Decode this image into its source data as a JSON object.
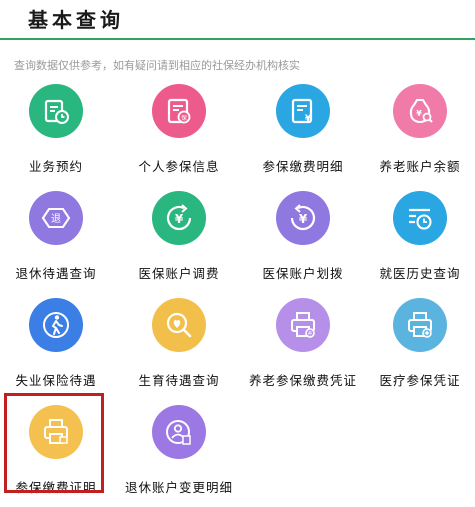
{
  "header": {
    "title": "基本查询"
  },
  "notice": "查询数据仅供参考，如有疑问请到相应的社保经办机构核实",
  "services": [
    {
      "label": "业务预约",
      "icon": "calendar-clock-icon",
      "color": "#29b67f"
    },
    {
      "label": "个人参保信息",
      "icon": "insurance-document-icon",
      "color": "#ec5b8c"
    },
    {
      "label": "参保缴费明细",
      "icon": "yuan-document-icon",
      "color": "#2aa7e2"
    },
    {
      "label": "养老账户余额",
      "icon": "money-bag-search-icon",
      "color": "#f07aa8"
    },
    {
      "label": "退休待遇查询",
      "icon": "retirement-hexagon-icon",
      "color": "#8f78e0"
    },
    {
      "label": "医保账户调费",
      "icon": "yuan-refresh-icon",
      "color": "#29b67f"
    },
    {
      "label": "医保账户划拨",
      "icon": "yuan-transfer-icon",
      "color": "#8f78e0"
    },
    {
      "label": "就医历史查询",
      "icon": "history-list-icon",
      "color": "#2aa7e2"
    },
    {
      "label": "失业保险待遇",
      "icon": "walking-person-icon",
      "color": "#3b7ee5"
    },
    {
      "label": "生育待遇查询",
      "icon": "maternity-search-icon",
      "color": "#f2c04a"
    },
    {
      "label": "养老参保缴费凭证",
      "icon": "printer-pension-icon",
      "color": "#b690e8"
    },
    {
      "label": "医疗参保凭证",
      "icon": "printer-medical-icon",
      "color": "#5bb4e0"
    },
    {
      "label": "参保缴费证明",
      "icon": "printer-certificate-icon",
      "color": "#f4c04f"
    },
    {
      "label": "退休账户变更明细",
      "icon": "person-document-icon",
      "color": "#9b78e4"
    }
  ]
}
